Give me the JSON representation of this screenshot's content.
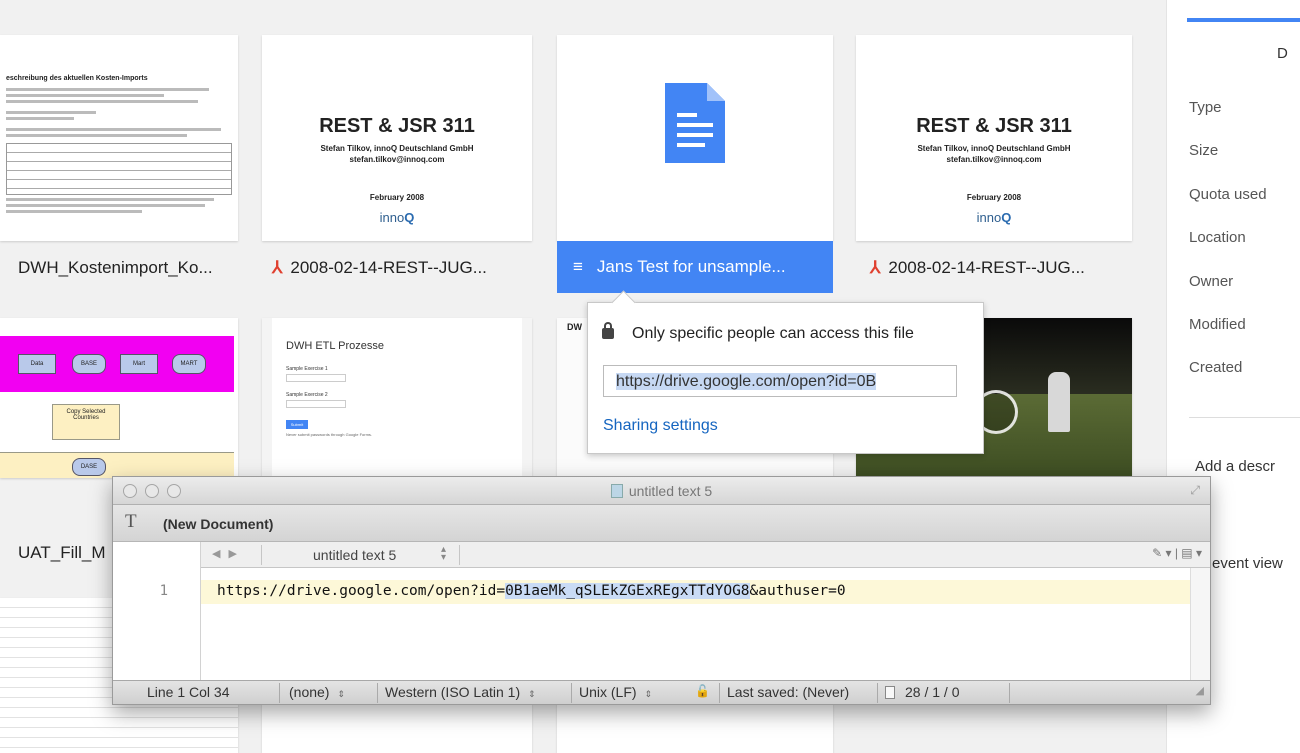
{
  "files": [
    {
      "name": "DWH_Kostenimport_Ko...",
      "kind": "doc"
    },
    {
      "name": "2008-02-14-REST--JUG...",
      "kind": "pdf"
    },
    {
      "name": "Jans Test for unsample...",
      "kind": "gdoc"
    },
    {
      "name": "2008-02-14-REST--JUG...",
      "kind": "pdf"
    },
    {
      "name": "UAT_Fill_M",
      "kind": "sheet"
    }
  ],
  "preview_rest": {
    "title": "REST & JSR 311",
    "sub1": "Stefan Tilkov, innoQ Deutschland GmbH",
    "sub2": "stefan.tilkov@innoq.com",
    "date": "February 2008",
    "logo_a": "inno",
    "logo_b": "Q"
  },
  "preview_doc1": {
    "heading": "eschreibung des aktuellen Kosten-Imports"
  },
  "preview_form": {
    "title": "DWH ETL Prozesse",
    "q1": "Sample Exercise 1",
    "q2": "Sample Exercise 2",
    "submit": "Submit",
    "note": "Never submit passwords through Google Forms."
  },
  "preview_flow": {
    "n1": "Data",
    "n2": "BASE",
    "n3": "Mart",
    "n4": "MART",
    "n5": "Copy Selected Countries",
    "n6": "DASE"
  },
  "share_popup": {
    "message": "Only specific people can access this file",
    "url": "https://drive.google.com/open?id=0B",
    "link": "Sharing settings"
  },
  "details_panel": {
    "tab_letter": "D",
    "rows": [
      "Type",
      "Size",
      "Quota used",
      "Location",
      "Owner",
      "Modified",
      "Created"
    ],
    "add_description": "Add a descr",
    "event_view": "event view"
  },
  "editor": {
    "window_title": "untitled text 5",
    "doc_label": "(New Document)",
    "tab_name": "untitled text 5",
    "line_number": "1",
    "line_before": "https://drive.google.com/open?id=",
    "line_selected": "0B1aeMk_qSLEkZGExREgxTTdYOG8",
    "line_after": "&authuser=0",
    "status": {
      "position": "Line 1 Col 34",
      "syntax": "(none)",
      "encoding": "Western (ISO Latin 1)",
      "line_endings": "Unix (LF)",
      "last_saved": "Last saved: (Never)",
      "counts": "28 / 1 / 0"
    }
  }
}
